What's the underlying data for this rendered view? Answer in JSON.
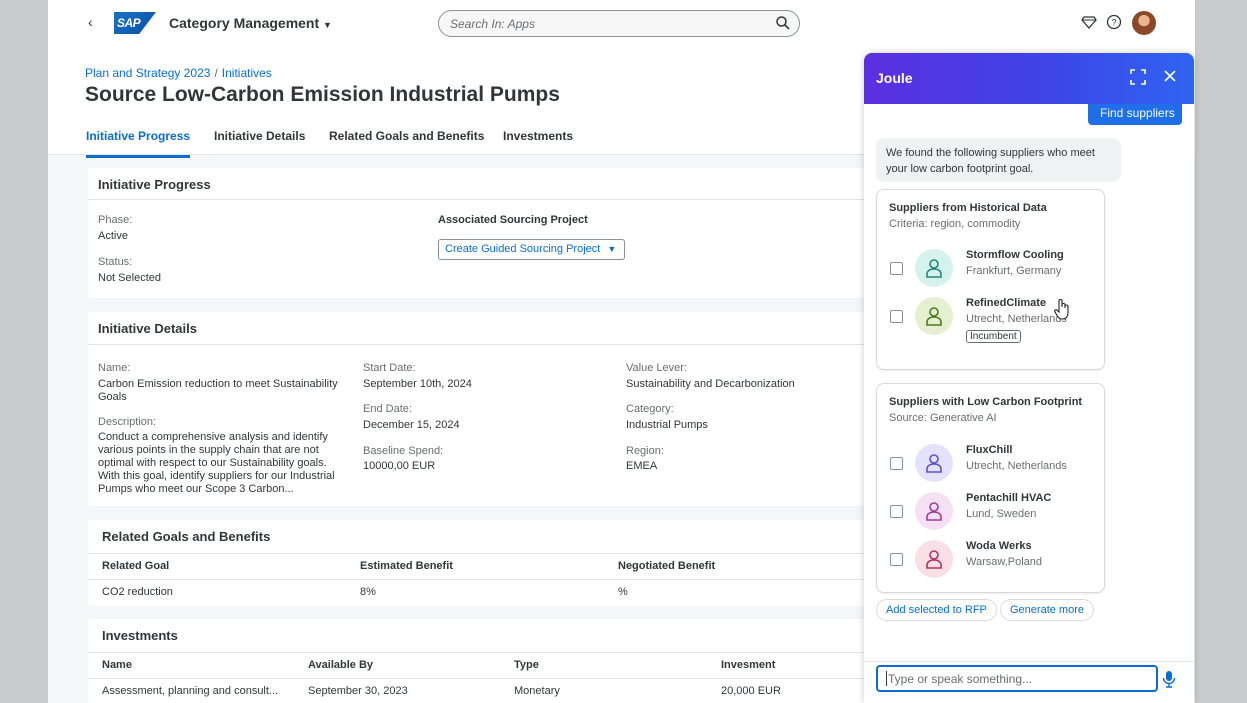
{
  "shell": {
    "app_title": "Category Management",
    "logo_text": "SAP",
    "search_placeholder": "Search In: Apps"
  },
  "header": {
    "breadcrumb": [
      "Plan and Strategy 2023",
      "Initiatives"
    ],
    "breadcrumb_sep": "/",
    "title": "Source Low-Carbon Emission Industrial Pumps",
    "tabs": [
      "Initiative Progress",
      "Initiative Details",
      "Related Goals and Benefits",
      "Investments"
    ],
    "active_tab": "Initiative Progress"
  },
  "progress": {
    "title": "Initiative Progress",
    "phase_label": "Phase:",
    "phase_value": "Active",
    "status_label": "Status:",
    "status_value": "Not Selected",
    "sourcing_label": "Associated Sourcing Project",
    "sourcing_button": "Create Guided Sourcing Project"
  },
  "details": {
    "title": "Initiative Details",
    "name_label": "Name:",
    "name_value": "Carbon Emission reduction to meet Sustainability Goals",
    "desc_label": "Description:",
    "desc_value": "Conduct a comprehensive analysis and identify various points in the supply chain that are not optimal with respect to our Sustainability goals. With this goal, identify suppliers for our Industrial Pumps who meet our Scope 3 Carbon...",
    "start_label": "Start Date:",
    "start_value": "September 10th, 2024",
    "end_label": "End Date:",
    "end_value": "December 15, 2024",
    "baseline_label": "Baseline Spend:",
    "baseline_value": "10000,00 EUR",
    "lever_label": "Value Lever:",
    "lever_value": "Sustainability and Decarbonization",
    "category_label": "Category:",
    "category_value": "Industrial Pumps",
    "region_label": "Region:",
    "region_value": "EMEA"
  },
  "goals": {
    "title": "Related Goals and Benefits",
    "headers": [
      "Related Goal",
      "Estimated Benefit",
      "Negotiated Benefit"
    ],
    "rows": [
      [
        "CO2 reduction",
        "8%",
        "%"
      ]
    ]
  },
  "investments": {
    "title": "Investments",
    "headers": [
      "Name",
      "Available By",
      "Type",
      "Invesment"
    ],
    "rows": [
      [
        "Assessment, planning and consult...",
        "September 30, 2023",
        "Monetary",
        "20,000 EUR"
      ]
    ]
  },
  "joule": {
    "title": "Joule",
    "user_message": "Find suppliers",
    "bot_message": "We found the following suppliers who meet your low carbon footprint goal.",
    "historical": {
      "title": "Suppliers from Historical Data",
      "subtitle": "Criteria: region, commodity",
      "suppliers": [
        {
          "name": "Stormflow Cooling",
          "location": "Frankfurt, Germany",
          "color": "#d5f2ec",
          "icon_color": "#1f8a70"
        },
        {
          "name": "RefinedClimate",
          "location": "Utrecht, Netherlands",
          "badge": "Incumbent",
          "color": "#e4f0cf",
          "icon_color": "#4c7a1e"
        }
      ]
    },
    "lowcarbon": {
      "title": "Suppliers with Low Carbon Footprint",
      "subtitle": "Source: Generative AI",
      "suppliers": [
        {
          "name": "FluxChill",
          "location": "Utrecht, Netherlands",
          "color": "#e4e2fb",
          "icon_color": "#5b4fd1"
        },
        {
          "name": "Pentachill HVAC",
          "location": "Lund, Sweden",
          "color": "#f6e1f4",
          "icon_color": "#a3399a"
        },
        {
          "name": "Woda Werks",
          "location": "Warsaw,Poland",
          "color": "#f8e0e6",
          "icon_color": "#b4325a"
        }
      ]
    },
    "actions": [
      "Add selected to RFP",
      "Generate more"
    ],
    "input_placeholder": "Type or speak something..."
  }
}
